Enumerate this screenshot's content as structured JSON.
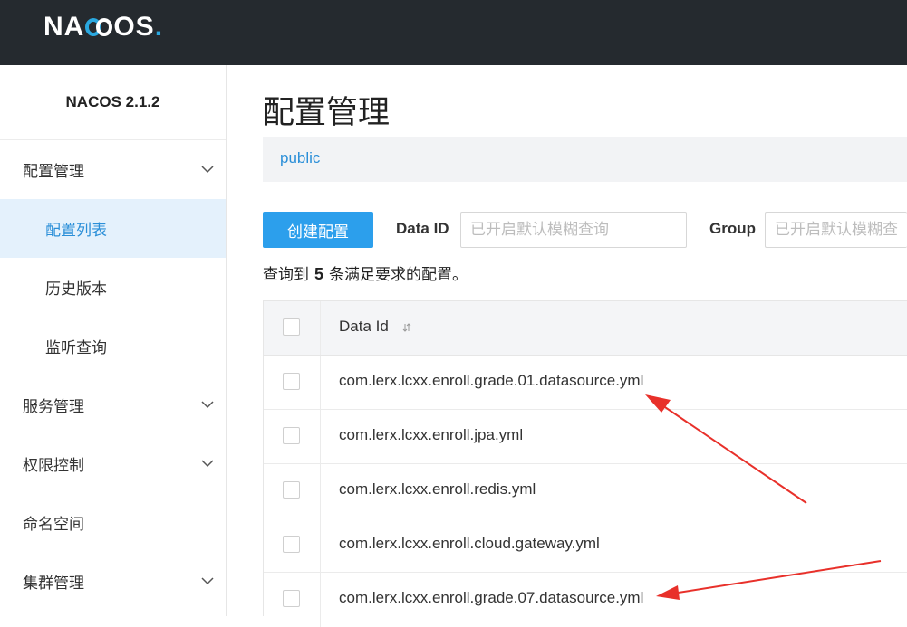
{
  "header": {
    "logo_text": "NACOS.",
    "logo_prefix": "NA",
    "logo_suffix": "OS",
    "logo_dot": "."
  },
  "sidebar": {
    "version": "NACOS 2.1.2",
    "items": [
      {
        "label": "配置管理",
        "type": "group",
        "expanded": true
      },
      {
        "label": "配置列表",
        "type": "sub",
        "active": true
      },
      {
        "label": "历史版本",
        "type": "sub"
      },
      {
        "label": "监听查询",
        "type": "sub"
      },
      {
        "label": "服务管理",
        "type": "group"
      },
      {
        "label": "权限控制",
        "type": "group"
      },
      {
        "label": "命名空间",
        "type": "group"
      },
      {
        "label": "集群管理",
        "type": "group"
      }
    ]
  },
  "main": {
    "title": "配置管理",
    "namespace": "public",
    "create_button": "创建配置",
    "filters": {
      "data_id_label": "Data ID",
      "data_id_placeholder": "已开启默认模糊查询",
      "group_label": "Group",
      "group_placeholder": "已开启默认模糊查询"
    },
    "summary": {
      "prefix": "查询到",
      "count": "5",
      "suffix": "条满足要求的配置。"
    },
    "table": {
      "header": "Data Id",
      "rows": [
        "com.lerx.lcxx.enroll.grade.01.datasource.yml",
        "com.lerx.lcxx.enroll.jpa.yml",
        "com.lerx.lcxx.enroll.redis.yml",
        "com.lerx.lcxx.enroll.cloud.gateway.yml",
        "com.lerx.lcxx.enroll.grade.07.datasource.yml"
      ]
    }
  },
  "colors": {
    "header_bg": "#252a2f",
    "accent": "#2c9fec",
    "active_bg": "#e4f1fc",
    "annotation_arrow": "#e8302a"
  }
}
